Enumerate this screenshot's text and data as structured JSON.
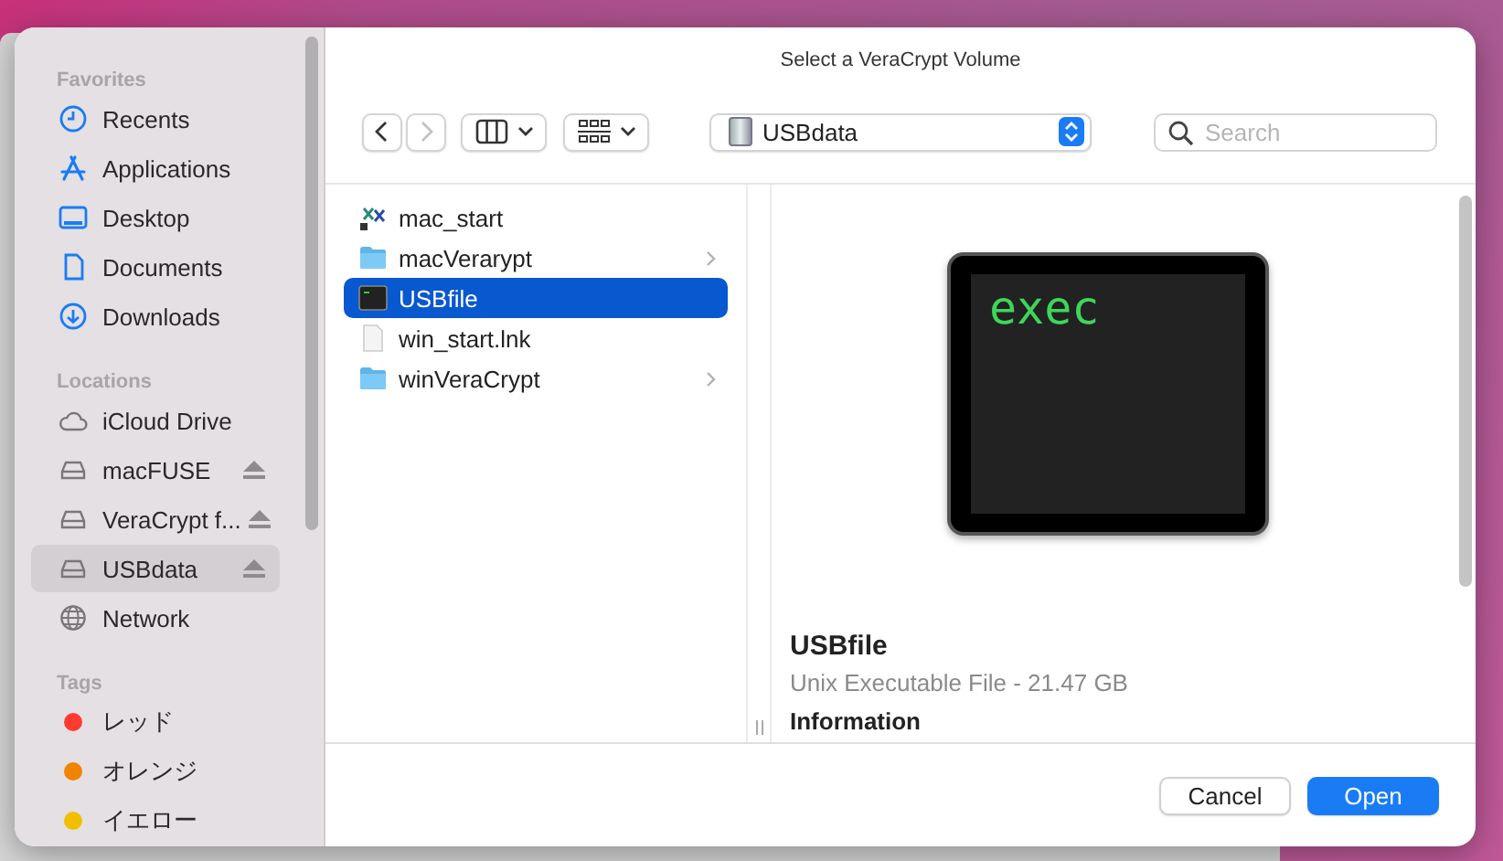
{
  "dialog": {
    "title": "Select a VeraCrypt Volume"
  },
  "sidebar": {
    "sections": [
      {
        "heading": "Favorites",
        "items": [
          {
            "label": "Recents",
            "kind": "clock",
            "selected": false,
            "eject": false
          },
          {
            "label": "Applications",
            "kind": "apps",
            "selected": false,
            "eject": false
          },
          {
            "label": "Desktop",
            "kind": "desktop",
            "selected": false,
            "eject": false
          },
          {
            "label": "Documents",
            "kind": "document",
            "selected": false,
            "eject": false
          },
          {
            "label": "Downloads",
            "kind": "download",
            "selected": false,
            "eject": false
          }
        ]
      },
      {
        "heading": "Locations",
        "items": [
          {
            "label": "iCloud Drive",
            "kind": "cloud",
            "selected": false,
            "eject": false
          },
          {
            "label": "macFUSE",
            "kind": "drive",
            "selected": false,
            "eject": true
          },
          {
            "label": "VeraCrypt f...",
            "kind": "drive",
            "selected": false,
            "eject": true
          },
          {
            "label": "USBdata",
            "kind": "drive",
            "selected": true,
            "eject": true
          },
          {
            "label": "Network",
            "kind": "network",
            "selected": false,
            "eject": false
          }
        ]
      },
      {
        "heading": "Tags",
        "items": [
          {
            "label": "レッド",
            "kind": "tag",
            "color": "#ff3b30",
            "selected": false,
            "eject": false
          },
          {
            "label": "オレンジ",
            "kind": "tag",
            "color": "#f08300",
            "selected": false,
            "eject": false
          },
          {
            "label": "イエロー",
            "kind": "tag",
            "color": "#f0c000",
            "selected": false,
            "eject": false
          }
        ]
      }
    ]
  },
  "toolbar": {
    "back": {
      "disabled": false
    },
    "forward": {
      "disabled": true
    },
    "location": "USBdata",
    "search": {
      "placeholder": "Search"
    }
  },
  "files": [
    {
      "name": "mac_start",
      "kind": "script",
      "selected": false
    },
    {
      "name": "macVerarypt",
      "kind": "folder",
      "selected": false
    },
    {
      "name": "USBfile",
      "kind": "terminal",
      "selected": true
    },
    {
      "name": "win_start.lnk",
      "kind": "document",
      "selected": false
    },
    {
      "name": "winVeraCrypt",
      "kind": "folder",
      "selected": false
    }
  ],
  "preview": {
    "icon_text": "exec",
    "name": "USBfile",
    "info": "Unix Executable File - 21.47 GB",
    "section": "Information"
  },
  "buttons": [
    {
      "label": "Cancel",
      "default": false
    },
    {
      "label": "Open",
      "default": true
    }
  ]
}
